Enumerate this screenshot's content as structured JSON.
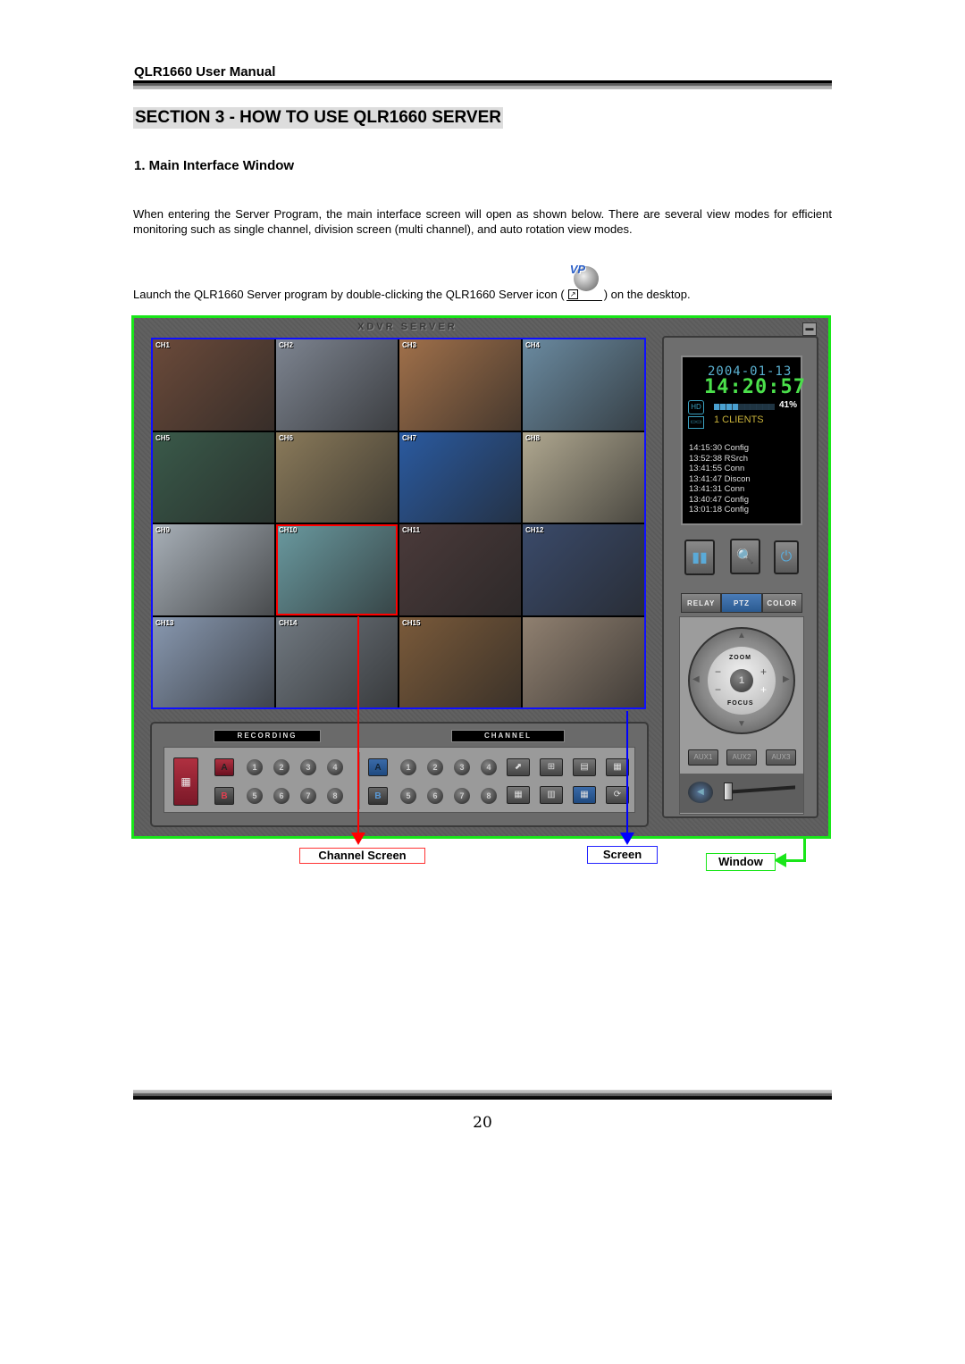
{
  "header": {
    "title": "QLR1660 User Manual"
  },
  "section_title": "SECTION 3 - HOW TO USE QLR1660 SERVER",
  "subsection_title": "1. Main Interface Window",
  "paragraph": "When entering the Server Program, the main interface screen will open as shown below. There are several view modes for efficient monitoring such as single channel, division screen (multi channel), and auto rotation view modes.",
  "launch": {
    "before": "Launch the QLR1660 Server program by double-clicking the QLR1660 Server icon (",
    "after": ") on the desktop.",
    "icon_text": "VP"
  },
  "app": {
    "title": "XDVR SERVER",
    "minimize_glyph": "▬",
    "channels": [
      {
        "label": "CH1",
        "color": "#6b4a3a"
      },
      {
        "label": "CH2",
        "color": "#7d8490"
      },
      {
        "label": "CH3",
        "color": "#a0704a"
      },
      {
        "label": "CH4",
        "color": "#6a8aa0"
      },
      {
        "label": "CH5",
        "color": "#3a5a4a"
      },
      {
        "label": "CH6",
        "color": "#8a7a5a"
      },
      {
        "label": "CH7",
        "color": "#2a5aa0"
      },
      {
        "label": "CH8",
        "color": "#b0a890"
      },
      {
        "label": "CH9",
        "color": "#a8b0b8"
      },
      {
        "label": "CH10",
        "color": "#6a9aa0"
      },
      {
        "label": "CH11",
        "color": "#4a3a3a"
      },
      {
        "label": "CH12",
        "color": "#3a4a6a"
      },
      {
        "label": "CH13",
        "color": "#8898b0"
      },
      {
        "label": "CH14",
        "color": "#707880"
      },
      {
        "label": "CH15",
        "color": "#7a5a3a"
      },
      {
        "label": "",
        "color": "#908070"
      }
    ],
    "selected_channel": "CH10",
    "status": {
      "date": "2004-01-13",
      "time": "14:20:57",
      "disk_usage_percent": 41,
      "disk_usage_label": "41%",
      "clients": "1 CLIENTS",
      "log": [
        "14:15:30 Config",
        "13:52:38 RSrch",
        "13:41:55 Conn",
        "13:41:47 Discon",
        "13:41:31 Conn",
        "13:40:47 Config",
        "13:01:18 Config"
      ]
    },
    "tool_buttons": [
      {
        "icon": "▮▮"
      },
      {
        "icon": "🔍"
      },
      {
        "icon": "⏻"
      }
    ],
    "tabs": [
      {
        "label": "RELAY",
        "active": false
      },
      {
        "label": "PTZ",
        "active": true
      },
      {
        "label": "COLOR",
        "active": false
      }
    ],
    "ptz": {
      "zoom": "ZOOM",
      "focus": "FOCUS",
      "center": "1",
      "minus": "−",
      "plus": "+",
      "up": "▲",
      "down": "▼",
      "left": "◀",
      "right": "▶"
    },
    "aux": [
      "AUX1",
      "AUX2",
      "AUX3"
    ],
    "volume_fraction": 0.0,
    "speaker_icon": "◀",
    "recording_label": "RECORDING",
    "channel_label": "CHANNEL",
    "schedule_icon": "▦",
    "rec_row1": [
      "A",
      "1",
      "2",
      "3",
      "4"
    ],
    "rec_row2": [
      "B",
      "5",
      "6",
      "7",
      "8"
    ],
    "ch_row1": [
      "A",
      "1",
      "2",
      "3",
      "4"
    ],
    "ch_row2": [
      "B",
      "5",
      "6",
      "7",
      "8"
    ],
    "view_row1": [
      "⬈",
      "⊞",
      "▤",
      "▦"
    ],
    "view_row2": [
      "▦",
      "▥",
      "▦",
      "⟳"
    ]
  },
  "callouts": {
    "channel_screen": "Channel Screen",
    "screen": "Screen",
    "window": "Window"
  },
  "colors": {
    "window": "#19e619",
    "screen": "#1010ff",
    "channel": "#ff0000"
  },
  "page_number": "20"
}
